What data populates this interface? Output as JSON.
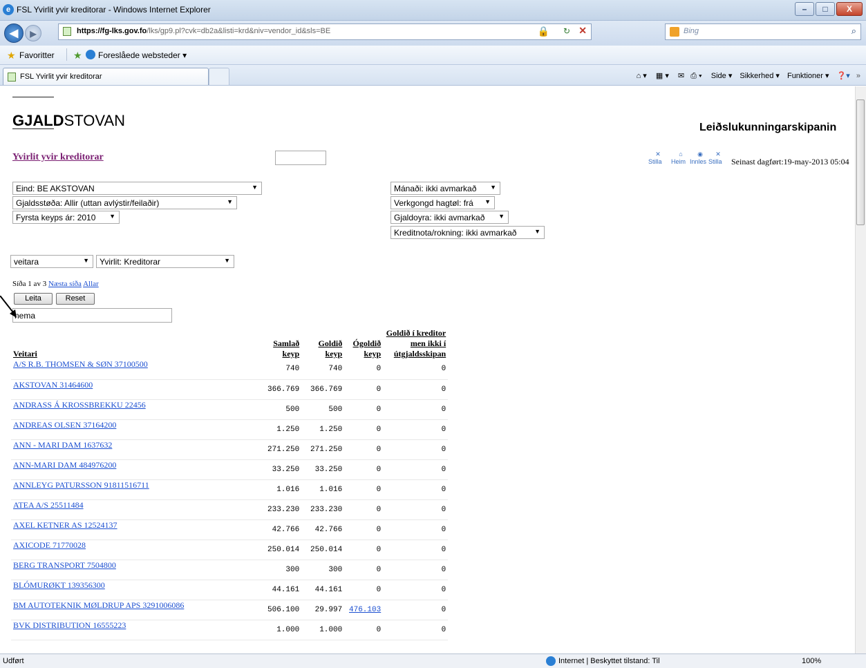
{
  "window": {
    "title": "FSL Yvirlit yvir kreditorar - Windows Internet Explorer",
    "min": "–",
    "max": "□",
    "close": "X"
  },
  "nav": {
    "url_host": "https://fg-lks.gov.fo",
    "url_rest": "/lks/gp9.pl?cvk=db2a&listi=krd&niv=vendor_id&sls=BE",
    "search_placeholder": "Bing",
    "back": "◀",
    "fwd": "▶"
  },
  "favbar": {
    "favorites": "Favoritter",
    "suggested": "Foreslåede websteder ▾"
  },
  "tabs": [
    {
      "label": "FSL Yvirlit yvir kreditorar"
    }
  ],
  "cmdbar": {
    "home": "⌂ ▾",
    "feeds": "▦ ▾",
    "mail": "✉",
    "print": "⎙ ▾",
    "page": "Side ▾",
    "safety": "Sikkerhed ▾",
    "tools": "Funktioner ▾",
    "help": "❓▾",
    "more": "»"
  },
  "page": {
    "logo_bold": "GJALD",
    "logo_rest": "STOVAN",
    "right_title": "Leiðslukunningarskipanin",
    "title": "Yvirlit yvir kreditorar",
    "icons": [
      "Stilla",
      "Heim",
      "Innles",
      "Stilla"
    ],
    "last_updated": "Seinast dagført:19-may-2013 05:04",
    "filters_left": [
      "Eind: BE AKSTOVAN",
      "Gjaldsstøða: Allir (uttan avlýstir/feilaðir)",
      "Fyrsta keyps ár: 2010"
    ],
    "filters_right": [
      "Mánaði: ikki avmarkað",
      "Verkgongd hagtøl: frá",
      "Gjaldoyra: ikki avmarkað",
      "Kreditnota/rokning: ikki avmarkað"
    ],
    "group_select": "veitara",
    "view_select": "Yvirlit: Kreditorar",
    "paging_text": "Síða 1 av 3",
    "next_page": "Næsta síða",
    "all": "Allar",
    "search_button": "Leita",
    "reset_button": "Reset",
    "filter_value": "nema"
  },
  "table": {
    "headers": [
      "Veitari",
      "Samlað keyp",
      "Goldið keyp",
      "Ógoldið keyp",
      "Goldið í kreditor men ikki í útgjaldsskipan"
    ],
    "rows": [
      {
        "name": "A/S R.B. THOMSEN & SØN 37100500",
        "total": "740",
        "paid": "740",
        "unpaid": "0",
        "pending": "0"
      },
      {
        "name": "AKSTOVAN 31464600",
        "total": "366.769",
        "paid": "366.769",
        "unpaid": "0",
        "pending": "0"
      },
      {
        "name": "ANDRASS Á KROSSBREKKU 22456",
        "total": "500",
        "paid": "500",
        "unpaid": "0",
        "pending": "0"
      },
      {
        "name": "ANDREAS OLSEN 37164200",
        "total": "1.250",
        "paid": "1.250",
        "unpaid": "0",
        "pending": "0"
      },
      {
        "name": "ANN - MARI DAM 1637632",
        "total": "271.250",
        "paid": "271.250",
        "unpaid": "0",
        "pending": "0"
      },
      {
        "name": "ANN-MARI DAM 484976200",
        "total": "33.250",
        "paid": "33.250",
        "unpaid": "0",
        "pending": "0"
      },
      {
        "name": "ANNLEYG PATURSSON 91811516711",
        "total": "1.016",
        "paid": "1.016",
        "unpaid": "0",
        "pending": "0"
      },
      {
        "name": "ATEA A/S 25511484",
        "total": "233.230",
        "paid": "233.230",
        "unpaid": "0",
        "pending": "0"
      },
      {
        "name": "AXEL KETNER AS 12524137",
        "total": "42.766",
        "paid": "42.766",
        "unpaid": "0",
        "pending": "0"
      },
      {
        "name": "AXICODE 71770028",
        "total": "250.014",
        "paid": "250.014",
        "unpaid": "0",
        "pending": "0"
      },
      {
        "name": "BERG TRANSPORT 7504800",
        "total": "300",
        "paid": "300",
        "unpaid": "0",
        "pending": "0"
      },
      {
        "name": "BLÓMURØKT 139356300",
        "total": "44.161",
        "paid": "44.161",
        "unpaid": "0",
        "pending": "0"
      },
      {
        "name": "BM AUTOTEKNIK MØLDRUP APS 3291006086",
        "total": "506.100",
        "paid": "29.997",
        "unpaid": "476.103",
        "pending": "0"
      },
      {
        "name": "BVK DISTRIBUTION 16555223",
        "total": "1.000",
        "paid": "1.000",
        "unpaid": "0",
        "pending": "0"
      }
    ]
  },
  "status": {
    "left": "Udført",
    "zone": "Internet | Beskyttet tilstand: Til",
    "zoom": "100%"
  }
}
